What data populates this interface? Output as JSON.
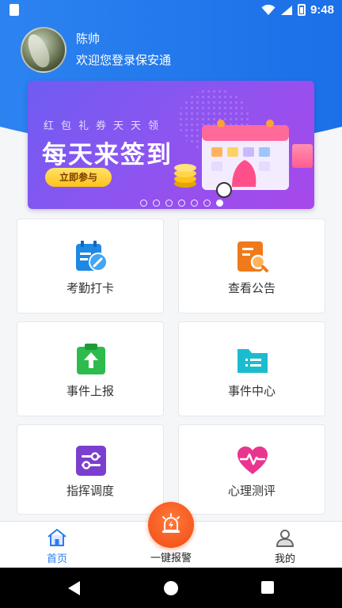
{
  "status_bar": {
    "time": "9:48"
  },
  "profile": {
    "name": "陈帅",
    "welcome": "欢迎您登录保安通"
  },
  "banner": {
    "subtitle": "红包礼券天天领",
    "title": "每天来签到",
    "button_label": "立即参与",
    "page_count": 7,
    "active_page": 7
  },
  "menu": [
    {
      "label": "考勤打卡",
      "icon": "attendance-icon",
      "color": "#1e88e5"
    },
    {
      "label": "查看公告",
      "icon": "notice-search-icon",
      "color": "#f07a1a"
    },
    {
      "label": "事件上报",
      "icon": "upload-report-icon",
      "color": "#2dbb4e"
    },
    {
      "label": "事件中心",
      "icon": "event-folder-icon",
      "color": "#1bbccf"
    },
    {
      "label": "指挥调度",
      "icon": "dispatch-sliders-icon",
      "color": "#7b3fd0"
    },
    {
      "label": "心理测评",
      "icon": "heart-pulse-icon",
      "color": "#e8368f"
    }
  ],
  "tabbar": {
    "home_label": "首页",
    "alarm_label": "一键报警",
    "mine_label": "我的"
  },
  "colors": {
    "accent": "#2c7cf2",
    "alarm": "#f24a14"
  }
}
